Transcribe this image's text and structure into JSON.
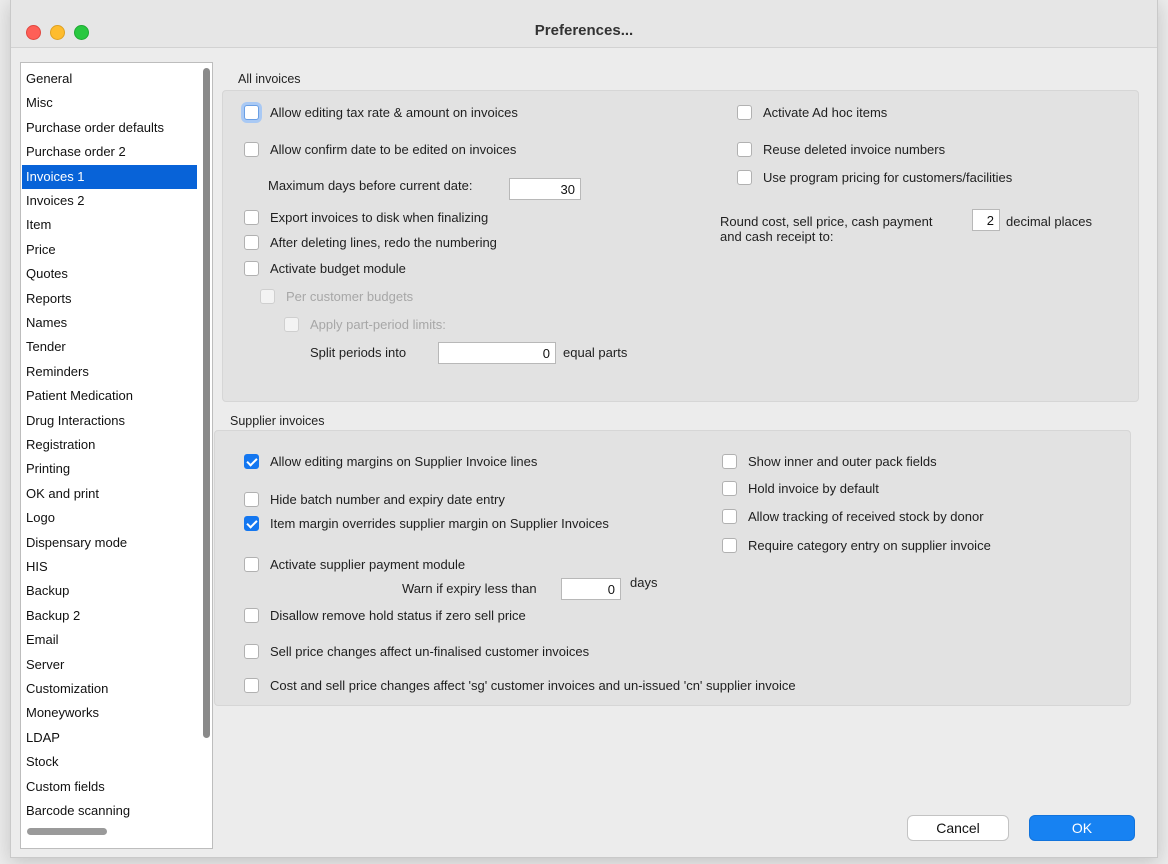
{
  "window": {
    "title": "Preferences..."
  },
  "sidebar": {
    "items": [
      {
        "label": "General"
      },
      {
        "label": "Misc"
      },
      {
        "label": "Purchase order defaults"
      },
      {
        "label": "Purchase order 2"
      },
      {
        "label": "Invoices 1",
        "selected": true
      },
      {
        "label": "Invoices 2"
      },
      {
        "label": "Item"
      },
      {
        "label": "Price"
      },
      {
        "label": "Quotes"
      },
      {
        "label": "Reports"
      },
      {
        "label": "Names"
      },
      {
        "label": "Tender"
      },
      {
        "label": "Reminders"
      },
      {
        "label": "Patient Medication"
      },
      {
        "label": "Drug Interactions"
      },
      {
        "label": "Registration"
      },
      {
        "label": "Printing"
      },
      {
        "label": "OK and print"
      },
      {
        "label": "Logo"
      },
      {
        "label": "Dispensary mode"
      },
      {
        "label": "HIS"
      },
      {
        "label": "Backup"
      },
      {
        "label": "Backup 2"
      },
      {
        "label": "Email"
      },
      {
        "label": "Server"
      },
      {
        "label": "Customization"
      },
      {
        "label": "Moneyworks"
      },
      {
        "label": "LDAP"
      },
      {
        "label": "Stock"
      },
      {
        "label": "Custom fields"
      },
      {
        "label": "Barcode scanning"
      }
    ]
  },
  "all_invoices": {
    "title": "All invoices",
    "allow_editing_tax": {
      "label": "Allow editing tax rate & amount on invoices",
      "checked": false
    },
    "allow_confirm_date": {
      "label": "Allow confirm date to be edited on invoices",
      "checked": false
    },
    "max_days": {
      "label": "Maximum days before current date:",
      "value": "30"
    },
    "export_to_disk": {
      "label": "Export invoices to disk when finalizing",
      "checked": false
    },
    "redo_numbering": {
      "label": "After deleting lines, redo the numbering",
      "checked": false
    },
    "activate_budget": {
      "label": "Activate budget module",
      "checked": false
    },
    "per_customer_budgets": {
      "label": "Per customer budgets",
      "checked": false
    },
    "apply_part_period": {
      "label": "Apply part-period limits:",
      "checked": false
    },
    "split_periods": {
      "prefix": "Split periods into",
      "value": "0",
      "suffix": "equal parts"
    },
    "activate_ad_hoc": {
      "label": "Activate Ad hoc items",
      "checked": false
    },
    "reuse_deleted": {
      "label": "Reuse deleted invoice numbers",
      "checked": false
    },
    "program_pricing": {
      "label": "Use program pricing for customers/facilities",
      "checked": false
    },
    "round_cost": {
      "label_line1": "Round cost, sell price, cash payment",
      "label_line2": "and cash receipt to:",
      "value": "2",
      "suffix": "decimal places"
    }
  },
  "supplier_invoices": {
    "title": "Supplier invoices",
    "allow_editing_margins": {
      "label": "Allow editing margins on Supplier Invoice lines",
      "checked": true
    },
    "hide_batch": {
      "label": "Hide batch number and expiry date entry",
      "checked": false
    },
    "item_margin_overrides": {
      "label": "Item margin overrides supplier margin on Supplier Invoices",
      "checked": true
    },
    "activate_payment": {
      "label": "Activate supplier payment module",
      "checked": false
    },
    "warn_expiry": {
      "prefix": "Warn if expiry less than",
      "value": "0",
      "suffix": "days"
    },
    "disallow_remove_hold": {
      "label": "Disallow remove hold status if zero sell price",
      "checked": false
    },
    "sell_price_changes": {
      "label": "Sell price changes affect un-finalised customer invoices",
      "checked": false
    },
    "cost_sell_changes": {
      "label": "Cost and sell price changes affect 'sg' customer invoices and un-issued 'cn' supplier invoice",
      "checked": false
    },
    "show_pack_fields": {
      "label": "Show inner and outer pack fields",
      "checked": false
    },
    "hold_by_default": {
      "label": "Hold invoice by default",
      "checked": false
    },
    "track_by_donor": {
      "label": "Allow tracking of received stock by donor",
      "checked": false
    },
    "require_category": {
      "label": "Require category entry on supplier invoice",
      "checked": false
    }
  },
  "buttons": {
    "cancel": "Cancel",
    "ok": "OK"
  }
}
